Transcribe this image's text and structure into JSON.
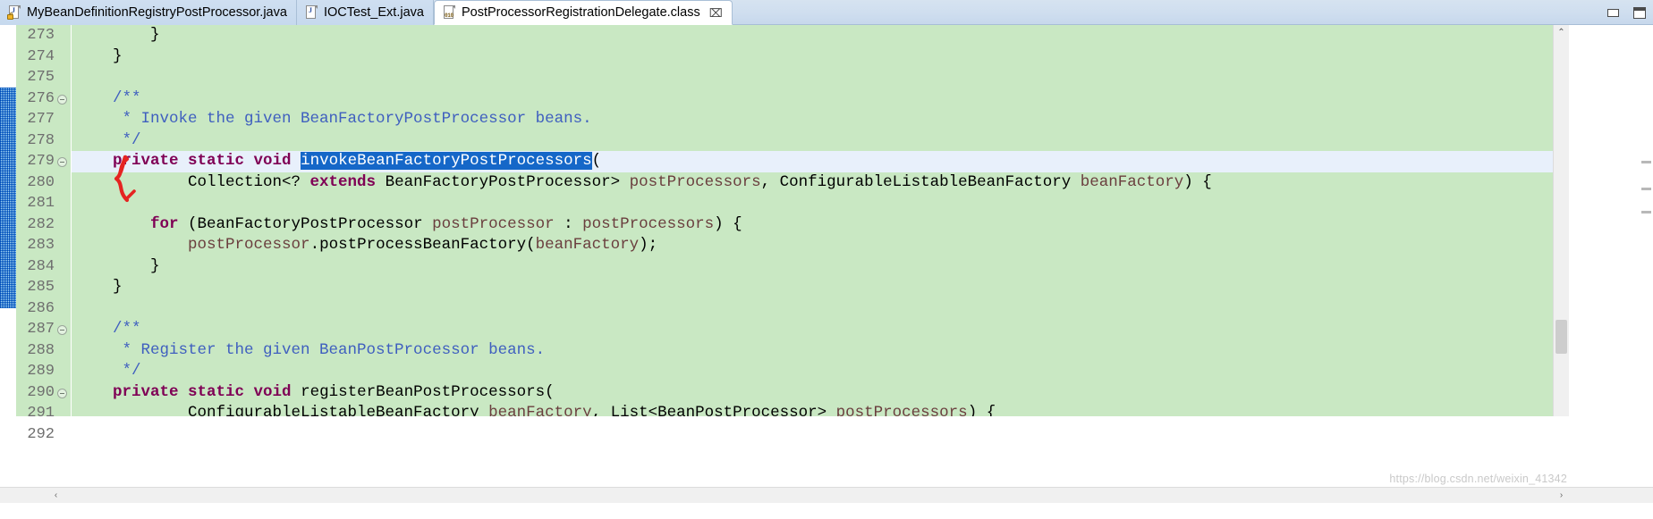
{
  "window": {
    "minimize_label": "Minimize",
    "maximize_label": "Maximize"
  },
  "tabs": [
    {
      "label": "MyBeanDefinitionRegistryPostProcessor.java",
      "icon": "java-file-locked-icon",
      "active": false,
      "closable": false
    },
    {
      "label": "IOCTest_Ext.java",
      "icon": "java-file-icon",
      "active": false,
      "closable": false
    },
    {
      "label": "PostProcessorRegistrationDelegate.class",
      "icon": "class-file-icon",
      "active": true,
      "closable": true,
      "close_glyph": "⌧"
    }
  ],
  "editor": {
    "selected_token": "invokeBeanFactoryPostProcessors",
    "current_line": 279,
    "colors": {
      "background": "#c9e8c3",
      "current_line": "#e8f0fb",
      "keyword": "#7f0055",
      "comment": "#3f5fbf",
      "selection": "#1567c8",
      "field": "#6a3e3e",
      "annotation_red": "#e52421"
    },
    "lines": [
      {
        "num": "273",
        "fold": false,
        "current": false,
        "tokens": [
          {
            "t": "plain",
            "s": "        }"
          }
        ]
      },
      {
        "num": "274",
        "fold": false,
        "current": false,
        "tokens": [
          {
            "t": "plain",
            "s": "    }"
          }
        ]
      },
      {
        "num": "275",
        "fold": false,
        "current": false,
        "tokens": [
          {
            "t": "plain",
            "s": ""
          }
        ]
      },
      {
        "num": "276",
        "fold": true,
        "current": false,
        "tokens": [
          {
            "t": "comment",
            "s": "    /**"
          }
        ]
      },
      {
        "num": "277",
        "fold": false,
        "current": false,
        "tokens": [
          {
            "t": "comment",
            "s": "     * Invoke the given BeanFactoryPostProcessor beans."
          }
        ]
      },
      {
        "num": "278",
        "fold": false,
        "current": false,
        "tokens": [
          {
            "t": "comment",
            "s": "     */"
          }
        ]
      },
      {
        "num": "279",
        "fold": true,
        "current": true,
        "tokens": [
          {
            "t": "plain",
            "s": "    "
          },
          {
            "t": "kw",
            "s": "private static void"
          },
          {
            "t": "plain",
            "s": " "
          },
          {
            "t": "sel",
            "s": "invokeBeanFactoryPostProcessors"
          },
          {
            "t": "plain",
            "s": "("
          }
        ]
      },
      {
        "num": "280",
        "fold": false,
        "current": false,
        "tokens": [
          {
            "t": "plain",
            "s": "            Collection<? "
          },
          {
            "t": "kw",
            "s": "extends"
          },
          {
            "t": "plain",
            "s": " BeanFactoryPostProcessor> "
          },
          {
            "t": "field",
            "s": "postProcessors"
          },
          {
            "t": "plain",
            "s": ", ConfigurableListableBeanFactory "
          },
          {
            "t": "field",
            "s": "beanFactory"
          },
          {
            "t": "plain",
            "s": ") {"
          }
        ]
      },
      {
        "num": "281",
        "fold": false,
        "current": false,
        "tokens": [
          {
            "t": "plain",
            "s": ""
          }
        ]
      },
      {
        "num": "282",
        "fold": false,
        "current": false,
        "tokens": [
          {
            "t": "plain",
            "s": "        "
          },
          {
            "t": "kw",
            "s": "for"
          },
          {
            "t": "plain",
            "s": " (BeanFactoryPostProcessor "
          },
          {
            "t": "field",
            "s": "postProcessor"
          },
          {
            "t": "plain",
            "s": " : "
          },
          {
            "t": "field",
            "s": "postProcessors"
          },
          {
            "t": "plain",
            "s": ") {"
          }
        ]
      },
      {
        "num": "283",
        "fold": false,
        "current": false,
        "tokens": [
          {
            "t": "plain",
            "s": "            "
          },
          {
            "t": "field",
            "s": "postProcessor"
          },
          {
            "t": "plain",
            "s": ".postProcessBeanFactory("
          },
          {
            "t": "field",
            "s": "beanFactory"
          },
          {
            "t": "plain",
            "s": ");"
          }
        ]
      },
      {
        "num": "284",
        "fold": false,
        "current": false,
        "tokens": [
          {
            "t": "plain",
            "s": "        }"
          }
        ]
      },
      {
        "num": "285",
        "fold": false,
        "current": false,
        "tokens": [
          {
            "t": "plain",
            "s": "    }"
          }
        ]
      },
      {
        "num": "286",
        "fold": false,
        "current": false,
        "tokens": [
          {
            "t": "plain",
            "s": ""
          }
        ]
      },
      {
        "num": "287",
        "fold": true,
        "current": false,
        "tokens": [
          {
            "t": "comment",
            "s": "    /**"
          }
        ]
      },
      {
        "num": "288",
        "fold": false,
        "current": false,
        "tokens": [
          {
            "t": "comment",
            "s": "     * Register the given BeanPostProcessor beans."
          }
        ]
      },
      {
        "num": "289",
        "fold": false,
        "current": false,
        "tokens": [
          {
            "t": "comment",
            "s": "     */"
          }
        ]
      },
      {
        "num": "290",
        "fold": true,
        "current": false,
        "tokens": [
          {
            "t": "plain",
            "s": "    "
          },
          {
            "t": "kw",
            "s": "private static void"
          },
          {
            "t": "plain",
            "s": " registerBeanPostProcessors("
          }
        ]
      },
      {
        "num": "291",
        "fold": false,
        "current": false,
        "tokens": [
          {
            "t": "plain",
            "s": "            ConfigurableListableBeanFactory "
          },
          {
            "t": "field",
            "s": "beanFactory"
          },
          {
            "t": "plain",
            "s": ", List<BeanPostProcessor> "
          },
          {
            "t": "field",
            "s": "postProcessors"
          },
          {
            "t": "plain",
            "s": ") {"
          }
        ]
      },
      {
        "num": "292",
        "fold": false,
        "current": false,
        "tokens": [
          {
            "t": "plain",
            "s": ""
          }
        ]
      }
    ]
  },
  "scrollbars": {
    "vertical_up_glyph": "⌃",
    "vertical_down_glyph": "⌄",
    "horizontal_left_glyph": "‹",
    "horizontal_right_glyph": "›"
  },
  "watermark": "https://blog.csdn.net/weixin_41342"
}
